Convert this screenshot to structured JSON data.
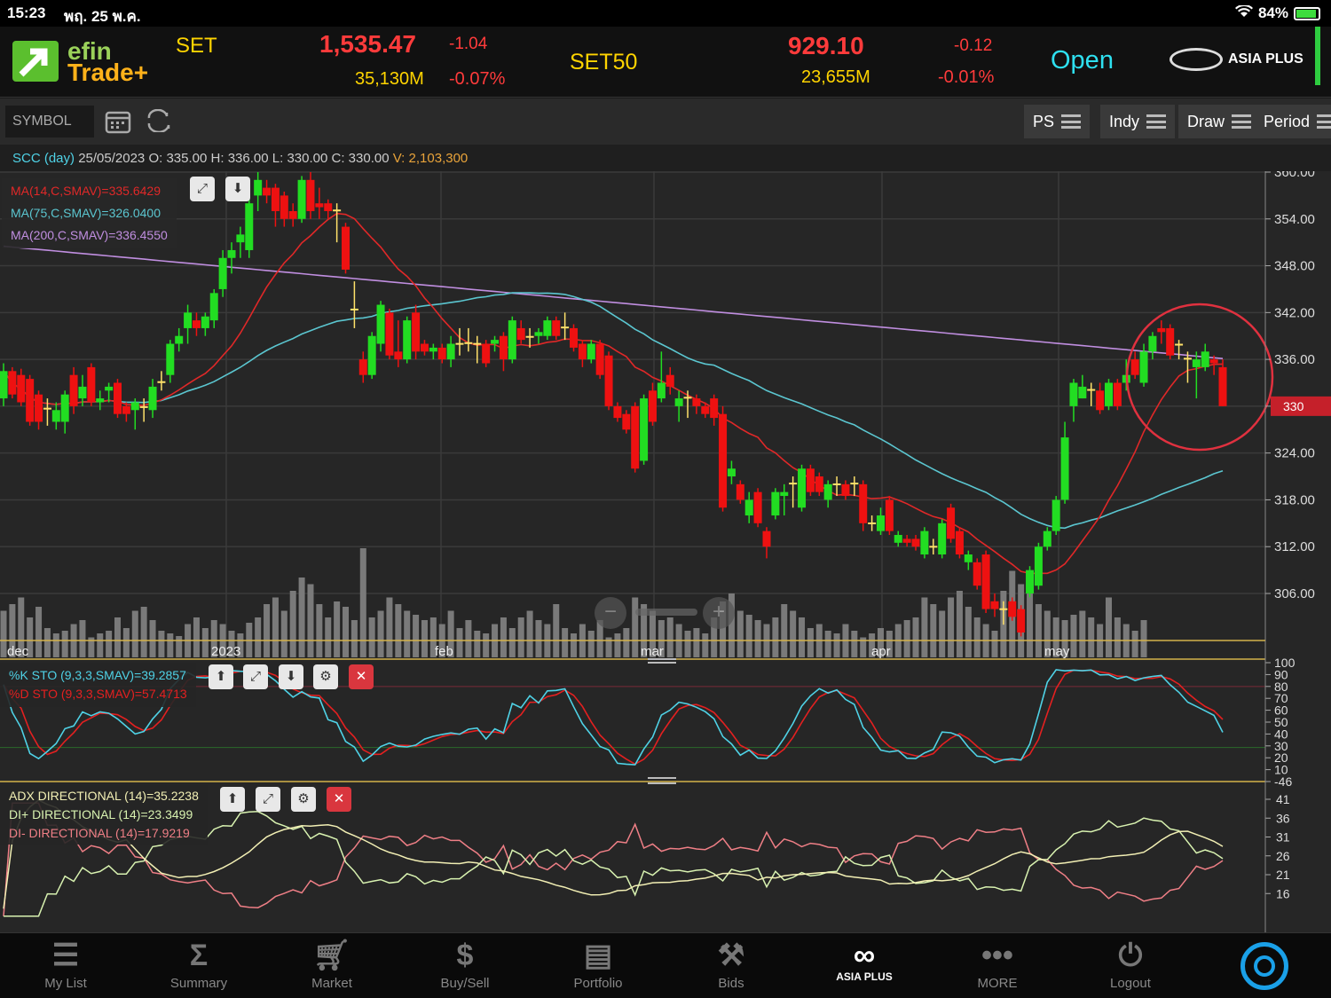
{
  "status_bar": {
    "time": "15:23",
    "date": "พฤ. 25 พ.ค.",
    "battery": "84%"
  },
  "header": {
    "logo_line1": "efin",
    "logo_line2": "Trade+",
    "set_label": "SET",
    "set_value": "1,535.47",
    "set_change": "-1.04",
    "set_volume": "35,130M",
    "set_pct": "-0.07%",
    "set50_label": "SET50",
    "set50_value": "929.10",
    "set50_change": "-0.12",
    "set50_volume": "23,655M",
    "set50_pct": "-0.01%",
    "market_status": "Open",
    "broker": "ASIA PLUS"
  },
  "toolbar": {
    "symbol_placeholder": "SYMBOL",
    "ps": "PS",
    "indy": "Indy",
    "draw": "Draw",
    "period": "Period"
  },
  "info": {
    "symbol": "SCC (day)",
    "date": "25/05/2023",
    "o_label": "O:",
    "o": "335.00",
    "h_label": "H:",
    "h": "336.00",
    "l_label": "L:",
    "l": "330.00",
    "c_label": "C:",
    "c": "330.00",
    "v_label": "V:",
    "v": "2,103,300"
  },
  "legends": {
    "ma14": "MA(14,C,SMAV)=335.6429",
    "ma75": "MA(75,C,SMAV)=326.0400",
    "ma200": "MA(200,C,SMAV)=336.4550",
    "stok": "%K STO (9,3,3,SMAV)=39.2857",
    "stod": "%D STO (9,3,3,SMAV)=57.4713",
    "adx": "ADX DIRECTIONAL (14)=35.2238",
    "diplus": "DI+ DIRECTIONAL (14)=23.3499",
    "diminus": "DI- DIRECTIONAL (14)=17.9219"
  },
  "price_axis": [
    "360.00",
    "354.00",
    "348.00",
    "342.00",
    "336.00",
    "330.00",
    "324.00",
    "318.00",
    "312.00",
    "306.00"
  ],
  "last_price_tag": "330",
  "x_labels": [
    "dec",
    "2023",
    "feb",
    "mar",
    "apr",
    "may"
  ],
  "sto_axis": [
    "100",
    "90",
    "80",
    "70",
    "60",
    "50",
    "40",
    "30",
    "20",
    "10",
    "-46"
  ],
  "adx_axis": [
    "41",
    "36",
    "31",
    "26",
    "21",
    "16"
  ],
  "colors": {
    "up": "#22dd22",
    "down": "#ee1111",
    "ma14": "#e02828",
    "ma75": "#5bc6d0",
    "ma200": "#c08ee0",
    "stok": "#4fd2e6",
    "stod": "#e42020",
    "adx": "#f2efb4",
    "diplus": "#d8f2b0",
    "diminus": "#ef7f86"
  },
  "tabs": [
    {
      "label": "My List",
      "icon": "list-icon"
    },
    {
      "label": "Summary",
      "icon": "sigma-icon"
    },
    {
      "label": "Market",
      "icon": "cart-icon"
    },
    {
      "label": "Buy/Sell",
      "icon": "dollar-icon"
    },
    {
      "label": "Portfolio",
      "icon": "document-icon"
    },
    {
      "label": "Bids",
      "icon": "gavel-icon"
    },
    {
      "label": "ASIA PLUS",
      "icon": "asiaplus-icon"
    },
    {
      "label": "MORE",
      "icon": "more-icon"
    },
    {
      "label": "Logout",
      "icon": "power-icon"
    }
  ],
  "chart_data": {
    "type": "candlestick",
    "series_name": "SCC (day)",
    "ylim": [
      300,
      360
    ],
    "period_labels": [
      "dec",
      "2023",
      "feb",
      "mar",
      "apr",
      "may"
    ],
    "candles": [
      {
        "o": 331,
        "c": 334.5,
        "h": 335.5,
        "l": 330
      },
      {
        "o": 334.5,
        "c": 331.5,
        "h": 335,
        "l": 331
      },
      {
        "o": 334,
        "c": 330.5,
        "h": 334.8,
        "l": 330
      },
      {
        "o": 333.5,
        "c": 328,
        "h": 334,
        "l": 327.5
      },
      {
        "o": 331.5,
        "c": 328,
        "h": 332,
        "l": 327
      },
      {
        "o": 329.8,
        "c": 329.6,
        "h": 331,
        "l": 327.5
      },
      {
        "o": 328,
        "c": 329.5,
        "h": 330.5,
        "l": 327
      },
      {
        "o": 328,
        "c": 331.5,
        "h": 332,
        "l": 326.5
      },
      {
        "o": 334,
        "c": 330,
        "h": 335,
        "l": 329
      },
      {
        "o": 331,
        "c": 332.5,
        "h": 334,
        "l": 330
      },
      {
        "o": 335,
        "c": 330.5,
        "h": 335.5,
        "l": 330
      },
      {
        "o": 330.5,
        "c": 331,
        "h": 332,
        "l": 329.5
      },
      {
        "o": 332,
        "c": 332.5,
        "h": 333,
        "l": 330.5
      },
      {
        "o": 333,
        "c": 329,
        "h": 333.5,
        "l": 328.5
      },
      {
        "o": 330,
        "c": 329,
        "h": 330.5,
        "l": 328
      },
      {
        "o": 329.5,
        "c": 330.5,
        "h": 331,
        "l": 327
      },
      {
        "o": 330,
        "c": 330,
        "h": 331,
        "l": 328
      },
      {
        "o": 329.5,
        "c": 332.5,
        "h": 333.5,
        "l": 328.5
      },
      {
        "o": 333,
        "c": 333.2,
        "h": 334.5,
        "l": 332
      },
      {
        "o": 334,
        "c": 338,
        "h": 338.5,
        "l": 333
      },
      {
        "o": 338,
        "c": 339,
        "h": 340,
        "l": 337
      },
      {
        "o": 340,
        "c": 342,
        "h": 343,
        "l": 338
      },
      {
        "o": 341,
        "c": 340,
        "h": 342,
        "l": 339
      },
      {
        "o": 340,
        "c": 341.5,
        "h": 342,
        "l": 339
      },
      {
        "o": 341,
        "c": 344.5,
        "h": 345,
        "l": 340
      },
      {
        "o": 345,
        "c": 349,
        "h": 350,
        "l": 344
      },
      {
        "o": 349,
        "c": 350,
        "h": 351,
        "l": 347
      },
      {
        "o": 351,
        "c": 352,
        "h": 353,
        "l": 349
      },
      {
        "o": 350,
        "c": 356,
        "h": 357,
        "l": 349
      },
      {
        "o": 357,
        "c": 359,
        "h": 360,
        "l": 355
      },
      {
        "o": 358,
        "c": 357,
        "h": 359,
        "l": 356
      },
      {
        "o": 358,
        "c": 355,
        "h": 358.5,
        "l": 353
      },
      {
        "o": 357,
        "c": 354,
        "h": 357.5,
        "l": 353
      },
      {
        "o": 355,
        "c": 354,
        "h": 356,
        "l": 353
      },
      {
        "o": 354,
        "c": 359,
        "h": 359.5,
        "l": 353.5
      },
      {
        "o": 359,
        "c": 355,
        "h": 360,
        "l": 354
      },
      {
        "o": 356,
        "c": 355.5,
        "h": 358,
        "l": 354
      },
      {
        "o": 356,
        "c": 355,
        "h": 356.5,
        "l": 354
      },
      {
        "o": 355.2,
        "c": 355.1,
        "h": 356,
        "l": 351
      },
      {
        "o": 353,
        "c": 347.5,
        "h": 353.5,
        "l": 347
      },
      {
        "o": 342.5,
        "c": 342.4,
        "h": 346,
        "l": 340
      },
      {
        "o": 336,
        "c": 334,
        "h": 337,
        "l": 333
      },
      {
        "o": 334,
        "c": 339,
        "h": 339.5,
        "l": 333.5
      },
      {
        "o": 338,
        "c": 343,
        "h": 343.5,
        "l": 337
      },
      {
        "o": 342,
        "c": 336.5,
        "h": 342.5,
        "l": 336
      },
      {
        "o": 337,
        "c": 336,
        "h": 341,
        "l": 335
      },
      {
        "o": 336,
        "c": 341,
        "h": 341.5,
        "l": 335.5
      },
      {
        "o": 342,
        "c": 337,
        "h": 343,
        "l": 336
      },
      {
        "o": 338,
        "c": 337,
        "h": 338.5,
        "l": 336.5
      },
      {
        "o": 337,
        "c": 337.5,
        "h": 338,
        "l": 336
      },
      {
        "o": 337.5,
        "c": 336,
        "h": 338,
        "l": 335.5
      },
      {
        "o": 336,
        "c": 338,
        "h": 339,
        "l": 335
      },
      {
        "o": 338,
        "c": 338.1,
        "h": 340,
        "l": 336.5
      },
      {
        "o": 338,
        "c": 338.2,
        "h": 340,
        "l": 337
      },
      {
        "o": 338,
        "c": 338.1,
        "h": 339,
        "l": 335.5
      },
      {
        "o": 338,
        "c": 335.5,
        "h": 338.5,
        "l": 335
      },
      {
        "o": 338,
        "c": 338.5,
        "h": 339,
        "l": 337
      },
      {
        "o": 339,
        "c": 336,
        "h": 339.5,
        "l": 334.5
      },
      {
        "o": 336,
        "c": 341,
        "h": 341.5,
        "l": 335.5
      },
      {
        "o": 340,
        "c": 338.5,
        "h": 341,
        "l": 338
      },
      {
        "o": 339,
        "c": 338.9,
        "h": 340,
        "l": 337.5
      },
      {
        "o": 339,
        "c": 339.5,
        "h": 340,
        "l": 338
      },
      {
        "o": 339,
        "c": 341,
        "h": 341.5,
        "l": 338.5
      },
      {
        "o": 341,
        "c": 339,
        "h": 341.5,
        "l": 338.5
      },
      {
        "o": 340,
        "c": 340.2,
        "h": 342,
        "l": 338.5
      },
      {
        "o": 340,
        "c": 337.5,
        "h": 340.5,
        "l": 337
      },
      {
        "o": 338,
        "c": 336,
        "h": 338.5,
        "l": 335
      },
      {
        "o": 336,
        "c": 338,
        "h": 338.5,
        "l": 335.5
      },
      {
        "o": 338,
        "c": 334,
        "h": 338.5,
        "l": 333.5
      },
      {
        "o": 336.5,
        "c": 330,
        "h": 337,
        "l": 329.5
      },
      {
        "o": 330,
        "c": 328.5,
        "h": 330.5,
        "l": 328
      },
      {
        "o": 329,
        "c": 327,
        "h": 329.5,
        "l": 326.5
      },
      {
        "o": 330,
        "c": 322,
        "h": 330.5,
        "l": 321.5
      },
      {
        "o": 323,
        "c": 331,
        "h": 331.5,
        "l": 322.5
      },
      {
        "o": 332,
        "c": 328,
        "h": 333,
        "l": 327.5
      },
      {
        "o": 331,
        "c": 333,
        "h": 337,
        "l": 330.5
      },
      {
        "o": 334,
        "c": 332.5,
        "h": 335,
        "l": 331.5
      },
      {
        "o": 330,
        "c": 331,
        "h": 332,
        "l": 328
      },
      {
        "o": 331,
        "c": 331.2,
        "h": 332,
        "l": 328.5
      },
      {
        "o": 331,
        "c": 330,
        "h": 331.5,
        "l": 329
      },
      {
        "o": 330,
        "c": 329,
        "h": 330.5,
        "l": 328.5
      },
      {
        "o": 331,
        "c": 328.5,
        "h": 331.5,
        "l": 327.5
      },
      {
        "o": 329,
        "c": 317,
        "h": 330,
        "l": 316.5
      },
      {
        "o": 321,
        "c": 322,
        "h": 323,
        "l": 320
      },
      {
        "o": 320,
        "c": 318,
        "h": 320.5,
        "l": 317.5
      },
      {
        "o": 316,
        "c": 318,
        "h": 319,
        "l": 315
      },
      {
        "o": 319,
        "c": 315,
        "h": 319.5,
        "l": 314.5
      },
      {
        "o": 314,
        "c": 312,
        "h": 314.5,
        "l": 310.5
      },
      {
        "o": 316,
        "c": 319,
        "h": 319.5,
        "l": 315.5
      },
      {
        "o": 318.5,
        "c": 319,
        "h": 320,
        "l": 316
      },
      {
        "o": 320,
        "c": 320.2,
        "h": 321,
        "l": 317
      },
      {
        "o": 317,
        "c": 322,
        "h": 322.5,
        "l": 316.5
      },
      {
        "o": 322,
        "c": 319,
        "h": 322.5,
        "l": 318.5
      },
      {
        "o": 321,
        "c": 319,
        "h": 321.5,
        "l": 318.5
      },
      {
        "o": 318,
        "c": 320,
        "h": 320.5,
        "l": 317
      },
      {
        "o": 320,
        "c": 320.1,
        "h": 321,
        "l": 318.5
      },
      {
        "o": 320,
        "c": 318.5,
        "h": 320.5,
        "l": 318
      },
      {
        "o": 320,
        "c": 320.2,
        "h": 321,
        "l": 318.5
      },
      {
        "o": 320,
        "c": 315,
        "h": 320.5,
        "l": 314
      },
      {
        "o": 315,
        "c": 315.1,
        "h": 316,
        "l": 314
      },
      {
        "o": 314,
        "c": 316,
        "h": 317,
        "l": 313.5
      },
      {
        "o": 318,
        "c": 314,
        "h": 318.5,
        "l": 313.5
      },
      {
        "o": 312.5,
        "c": 313.5,
        "h": 314,
        "l": 312
      },
      {
        "o": 313,
        "c": 312.5,
        "h": 313.5,
        "l": 312
      },
      {
        "o": 313,
        "c": 312,
        "h": 313.5,
        "l": 311.5
      },
      {
        "o": 311,
        "c": 314,
        "h": 314.5,
        "l": 310.5
      },
      {
        "o": 312,
        "c": 312.1,
        "h": 313,
        "l": 311
      },
      {
        "o": 311,
        "c": 315,
        "h": 315.5,
        "l": 310.5
      },
      {
        "o": 317,
        "c": 313,
        "h": 317.5,
        "l": 312.5
      },
      {
        "o": 314,
        "c": 311,
        "h": 314.5,
        "l": 310.5
      },
      {
        "o": 310,
        "c": 311,
        "h": 311.5,
        "l": 309
      },
      {
        "o": 310,
        "c": 307,
        "h": 310.5,
        "l": 306.5
      },
      {
        "o": 311,
        "c": 304,
        "h": 311.5,
        "l": 303.5
      },
      {
        "o": 305,
        "c": 304,
        "h": 306,
        "l": 303
      },
      {
        "o": 304,
        "c": 304.1,
        "h": 305,
        "l": 302
      },
      {
        "o": 305,
        "c": 303,
        "h": 305.5,
        "l": 302.5
      },
      {
        "o": 304,
        "c": 301,
        "h": 304.5,
        "l": 300.5
      },
      {
        "o": 306,
        "c": 309,
        "h": 309.5,
        "l": 305.5
      },
      {
        "o": 307,
        "c": 312,
        "h": 312.5,
        "l": 306.5
      },
      {
        "o": 312,
        "c": 314,
        "h": 314.5,
        "l": 311.5
      },
      {
        "o": 314,
        "c": 318,
        "h": 318.5,
        "l": 313.5
      },
      {
        "o": 318,
        "c": 326,
        "h": 328,
        "l": 317.5
      },
      {
        "o": 330,
        "c": 333,
        "h": 333.5,
        "l": 328
      },
      {
        "o": 331,
        "c": 332.5,
        "h": 334,
        "l": 331
      },
      {
        "o": 332,
        "c": 332.2,
        "h": 333,
        "l": 330
      },
      {
        "o": 332,
        "c": 329.5,
        "h": 333,
        "l": 329
      },
      {
        "o": 330,
        "c": 333,
        "h": 333.5,
        "l": 329.5
      },
      {
        "o": 333,
        "c": 330,
        "h": 333.5,
        "l": 329.5
      },
      {
        "o": 333,
        "c": 334,
        "h": 336,
        "l": 332
      },
      {
        "o": 336,
        "c": 334,
        "h": 337,
        "l": 333.5
      },
      {
        "o": 333,
        "c": 337,
        "h": 338,
        "l": 332.5
      },
      {
        "o": 337,
        "c": 339,
        "h": 339.5,
        "l": 336
      },
      {
        "o": 340,
        "c": 339.5,
        "h": 341,
        "l": 338
      },
      {
        "o": 340,
        "c": 336.5,
        "h": 340.5,
        "l": 336
      },
      {
        "o": 338,
        "c": 337.9,
        "h": 338.5,
        "l": 336
      },
      {
        "o": 336,
        "c": 336.2,
        "h": 337,
        "l": 333
      },
      {
        "o": 335,
        "c": 336,
        "h": 337,
        "l": 331
      },
      {
        "o": 335,
        "c": 337,
        "h": 338,
        "l": 334.5
      },
      {
        "o": 336,
        "c": 335.5,
        "h": 336.5,
        "l": 334
      },
      {
        "o": 335,
        "c": 330,
        "h": 336,
        "l": 330
      }
    ],
    "volume": [
      35,
      40,
      45,
      30,
      38,
      22,
      18,
      20,
      25,
      28,
      15,
      18,
      20,
      30,
      22,
      35,
      38,
      28,
      20,
      18,
      16,
      25,
      30,
      22,
      28,
      25,
      20,
      18,
      26,
      30,
      40,
      45,
      35,
      50,
      60,
      55,
      40,
      30,
      42,
      38,
      28,
      82,
      30,
      35,
      45,
      40,
      35,
      32,
      28,
      30,
      25,
      35,
      22,
      28,
      20,
      18,
      25,
      30,
      22,
      30,
      35,
      28,
      25,
      40,
      22,
      18,
      25,
      20,
      28,
      15,
      18,
      22,
      45,
      40,
      35,
      28,
      30,
      25,
      20,
      22,
      18,
      30,
      42,
      48,
      35,
      32,
      28,
      25,
      30,
      40,
      35,
      30,
      22,
      25,
      20,
      18,
      25,
      20,
      15,
      18,
      22,
      20,
      25,
      28,
      30,
      45,
      40,
      35,
      45,
      50,
      38,
      30,
      25,
      20,
      50,
      65,
      55,
      48,
      40,
      35,
      30,
      28,
      32,
      35,
      30,
      25,
      45,
      30,
      25,
      20,
      28
    ],
    "overlays": [
      "MA(14,C,SMAV)",
      "MA(75,C,SMAV)",
      "MA(200,C,SMAV)"
    ],
    "indicators": [
      "%K STO (9,3,3,SMAV)",
      "%D STO (9,3,3,SMAV)",
      "ADX DIRECTIONAL (14)",
      "DI+ DIRECTIONAL (14)",
      "DI- DIRECTIONAL (14)"
    ]
  }
}
